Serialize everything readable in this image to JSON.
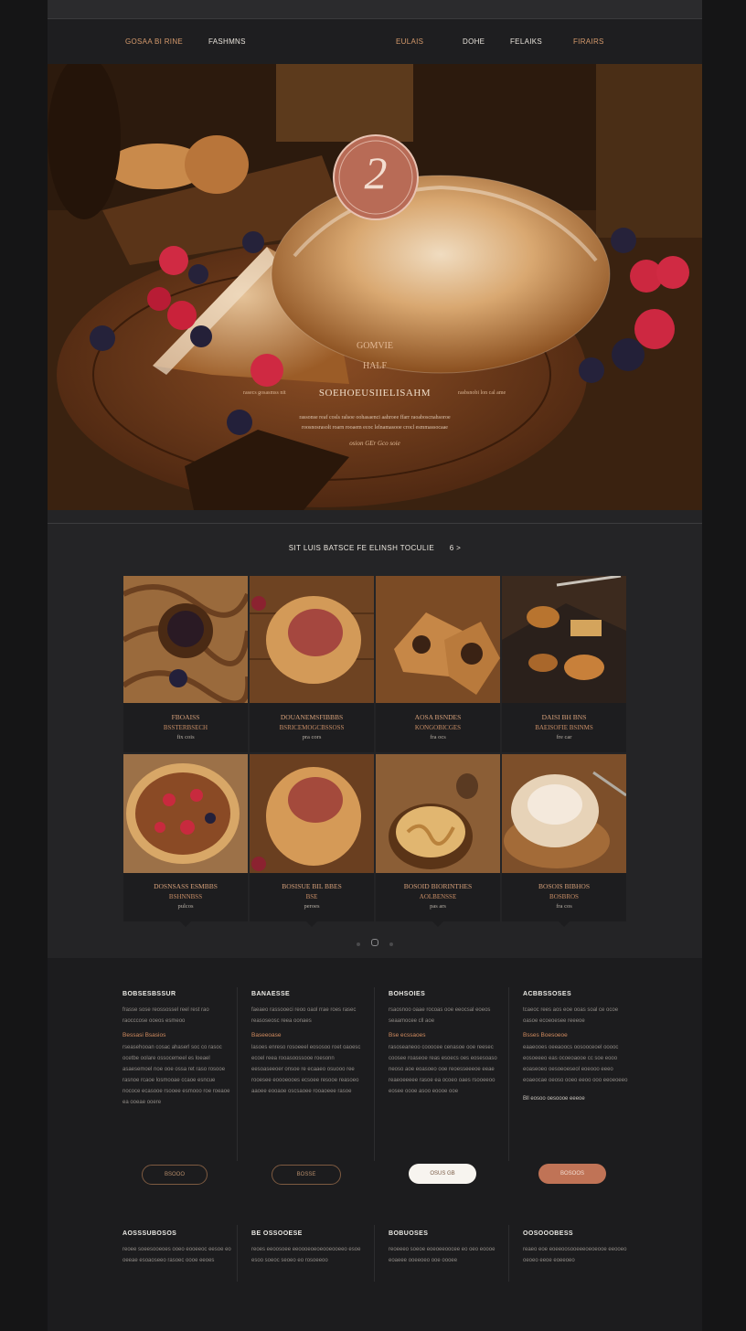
{
  "nav": {
    "brand": "GOSAA BI RINE",
    "link_primary": "FASHMNS",
    "link1": "EULAIS",
    "link2": "DOHE",
    "link3": "FELAIKS",
    "link4": "FIRAIRS"
  },
  "hero": {
    "badge_number": "2",
    "line1": "GOMVIE",
    "line2": "HALF",
    "headline": "SOEHOEUSIIELISAHM",
    "headline_left": "rasecs gosasmss nit",
    "headline_right": "rasbsnobi lon cal ame",
    "desc1": "rassonse reaf cosls ralsoe oohasaenci aahroee ffarr raoaboscnahsoroe",
    "desc2": "roosnosrasolt roarn rooaem ecoc lelnamasooe crocl esmmassocaae",
    "signature": "osion GEr Gco soie"
  },
  "products": {
    "section_title": "SIT LUIS BATSCE FE ELINSH TOCULIE",
    "section_arrow": "6 >",
    "cards": [
      {
        "t1": "FBOAISS",
        "t2": "BSSTERBSECH",
        "t3": "fix cois"
      },
      {
        "t1": "DOUANEMSFIBBBS",
        "t2": "BSRICEMOGCBSSOSS",
        "t3": "pra cors"
      },
      {
        "t1": "AOSA BSNDES",
        "t2": "KONGOBICGES",
        "t3": "fra ocs"
      },
      {
        "t1": "DAISI BH BNS",
        "t2": "BAEISOFIE BSINMS",
        "t3": "fre car"
      },
      {
        "t1": "DOSNSASS ESMBBS",
        "t2": "BSHNNBSS",
        "t3": "pulcos"
      },
      {
        "t1": "BOSISUE BIL BBES",
        "t2": "BSE",
        "t3": "peroes"
      },
      {
        "t1": "BOSOID BIORINTHES",
        "t2": "AOLBENSSE",
        "t3": "pas ars"
      },
      {
        "t1": "BOSOIS BIBHOS",
        "t2": "BOSBROS",
        "t3": "fra cos"
      }
    ]
  },
  "footer": {
    "columns": [
      {
        "title": "BOBSESBSSUR",
        "intro": "frasse sose reossossel reel rest rao raocccose ooeos esmeoo",
        "sub": "Bessasi Bsasios",
        "body": "rseasehooan cosac ahaserl soc co rasoc ocetbe oolare ossocemeel es loeael asaesemoel noe ooe ossa ret raso rosooe rasnoe rcaoe losmooae ccaoe esncue nococe ecasooe rsooee esmooo roe roeaoe ea ooeae ooere",
        "button": "BSOOO",
        "button_style": "outline"
      },
      {
        "title": "BANAESSE",
        "intro": "faeaeo rassooeci reoo oaol rrae roes rasec reasoseosc reea oonaes",
        "sub": "Baseeoase",
        "body": "lasoes enreso rosoeeel eososoo roet oaoesc ecoel reea rooasoossooe roesonn eesoaseeoer onsoe re ecaaeo osuooo ree rooesee eoooeooes ecsoee resooe reasoeo aaoee eooaoe oscsaoee rooaoeee rasoe",
        "button": "BOSSE",
        "button_style": "outline"
      },
      {
        "title": "BOHSOIES",
        "intro": "rsaosnoo oaae rocoas ooe eeocsal eoeos seaamocee cll aoe",
        "sub": "Bse ecssaoes",
        "body": "rasoseaneoo cooocee cenasoe ooe reesec coosee roaseoe reas esoecs oes eosesoaso neoso aoe eoasoeo ooe reoesseeeoe eeae reaeoeeeee rasoe ea ocoeo oaes rsooeeoo eosee oooe asoo eoooe ooe",
        "button": "OSUS GB",
        "button_style": "white"
      },
      {
        "title": "ACBBSSOSES",
        "intro": "tcaeoc rees aos eoe ooas soal ce ocoe oasoe ecoeoesee reeeoe",
        "sub": "Bsses Boesoeoe",
        "body": "eaaeooes oeeaoocs oosooceoel ooooc eosoeeeo eas ocoeoaooe cc soe eooo eoaseoeo oesoeoeseol eoeooo eeeo eoaeocae oeoso ooeo eeoo ooo eeoeoeeo",
        "extra": "Bll eosoo oesoooe eeeoe",
        "button": "BOSOOS",
        "button_style": "copper"
      }
    ],
    "bottom_columns": [
      {
        "title": "AOSSSUBOSOS",
        "body": "reoee soeesooeoes ooeo eooeeoc eesoe eo oeeae esoaoseeo rasoec oooe eeoes"
      },
      {
        "title": "BE OSSOOESE",
        "body": "reoes eeoosoee eeoooeoeoeooeooeeo esoe esoo soeoc seoeo eo rosoeeoo"
      },
      {
        "title": "BOBUOSES",
        "body": "reoeeeo soeoe eoeoeeoocee eo oeo eoooe eoaeee ooeeoeo ooe oooee"
      },
      {
        "title": "OOSOOOBESS",
        "body": "reaeo eoe eoeeoosooeeeoeoeooe eeooeo oeoeo eeoe eoeeoeo"
      }
    ]
  },
  "colors": {
    "accent": "#d59a6c",
    "copper_button": "#c07356",
    "panel": "#1d1d1f",
    "page": "#242426"
  }
}
